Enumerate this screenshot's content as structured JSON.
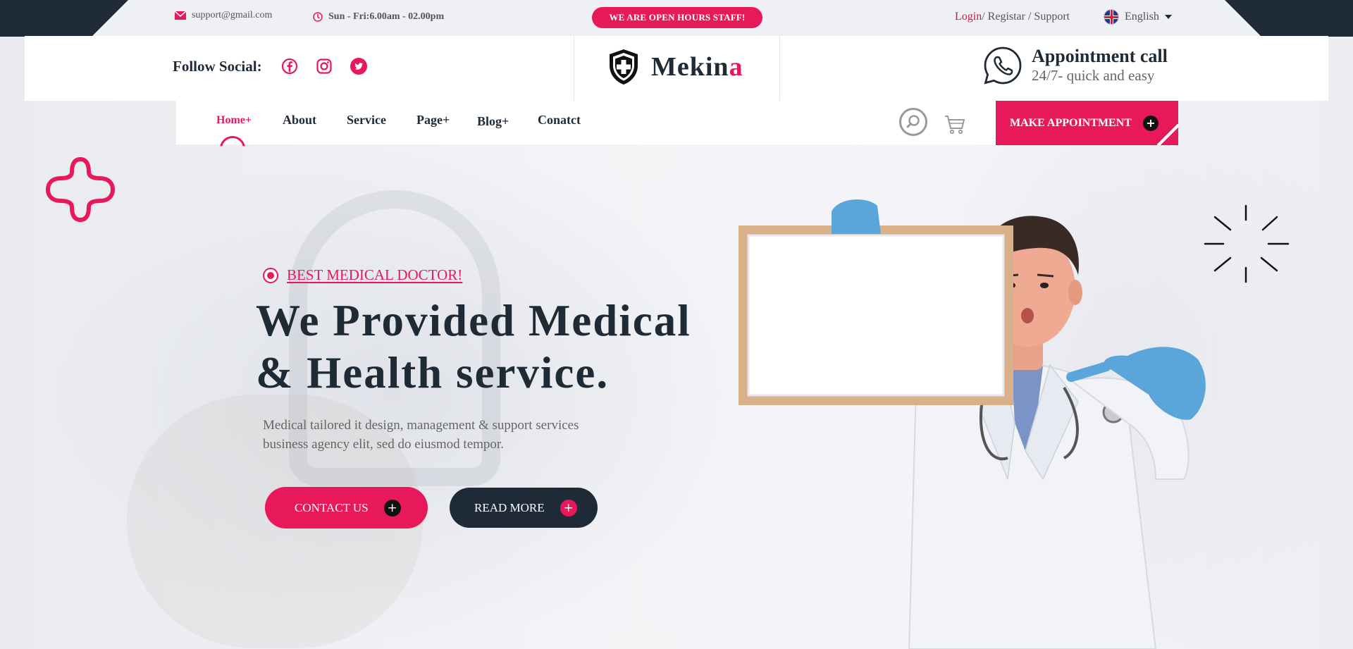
{
  "topbar": {
    "email": "support@gmail.com",
    "hours": "Sun - Fri:6.00am - 02.00pm",
    "badge": "WE ARE OPEN HOURS STAFF!",
    "login": "Login",
    "register_support": "/ Registar / Support",
    "language": "English"
  },
  "header": {
    "follow_label": "Follow Social:",
    "social": [
      "facebook-icon",
      "instagram-icon",
      "twitter-icon"
    ],
    "logo_main": "Mekin",
    "logo_accent": "a",
    "appointment_title": "Appointment call",
    "appointment_sub": "24/7- quick and easy"
  },
  "nav": {
    "items": [
      "Home+",
      "About",
      "Service",
      "Page+",
      "Blog+",
      "Conatct"
    ],
    "cta": "MAKE APPOINTMENT"
  },
  "hero": {
    "tagline": "BEST MEDICAL DOCTOR!",
    "headline_line1": "We Provided Medical",
    "headline_line2": "& Health service.",
    "desc_line1": "Medical tailored it design, management & support services",
    "desc_line2": "business agency elit, sed do eiusmod tempor.",
    "btn_contact": "CONTACT US",
    "btn_read": "READ MORE"
  },
  "colors": {
    "accent": "#e8195a",
    "dark": "#1e2a35"
  }
}
